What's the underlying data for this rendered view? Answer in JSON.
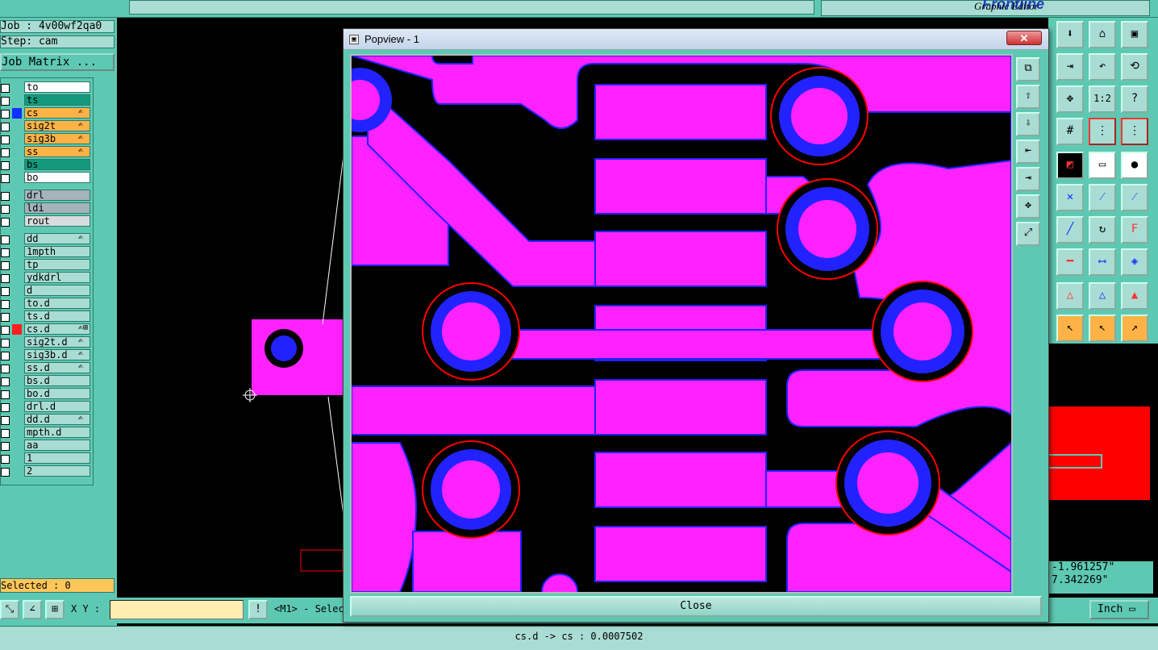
{
  "app": {
    "logo_text": "Frontline",
    "subtitle": "Graphic Editor"
  },
  "info": {
    "job": "Job : 4v00wf2qa0",
    "step": "Step: cam",
    "job_matrix": "Job Matrix ..."
  },
  "layers": [
    {
      "name": "to",
      "color": "#ffffff",
      "mark": "",
      "edit": ""
    },
    {
      "name": "ts",
      "color": "#139a7a",
      "mark": "",
      "edit": ""
    },
    {
      "name": "cs",
      "color": "#ffb347",
      "mark": "#1030ff",
      "edit": "✍"
    },
    {
      "name": "sig2t",
      "color": "#ffb347",
      "mark": "",
      "edit": "✍"
    },
    {
      "name": "sig3b",
      "color": "#ffb347",
      "mark": "",
      "edit": "✍"
    },
    {
      "name": "ss",
      "color": "#ffb347",
      "mark": "",
      "edit": "✍"
    },
    {
      "name": "bs",
      "color": "#139a7a",
      "mark": "",
      "edit": ""
    },
    {
      "name": "bo",
      "color": "#ffffff",
      "mark": "",
      "edit": ""
    },
    {
      "name": "drl",
      "color": "#a7b3bb",
      "mark": "",
      "edit": ""
    },
    {
      "name": "ldi",
      "color": "#a7b3bb",
      "mark": "",
      "edit": ""
    },
    {
      "name": "rout",
      "color": "#d9dcdc",
      "mark": "",
      "edit": ""
    },
    {
      "name": "dd",
      "color": "#a9dcd3",
      "mark": "",
      "edit": "✍"
    },
    {
      "name": "1mpth",
      "color": "#a9dcd3",
      "mark": "",
      "edit": ""
    },
    {
      "name": "tp",
      "color": "#a9dcd3",
      "mark": "",
      "edit": ""
    },
    {
      "name": "ydkdrl",
      "color": "#a9dcd3",
      "mark": "",
      "edit": ""
    },
    {
      "name": "d",
      "color": "#a9dcd3",
      "mark": "",
      "edit": ""
    },
    {
      "name": "to.d",
      "color": "#a9dcd3",
      "mark": "",
      "edit": ""
    },
    {
      "name": "ts.d",
      "color": "#a9dcd3",
      "mark": "",
      "edit": ""
    },
    {
      "name": "cs.d",
      "color": "#a9dcd3",
      "mark": "#ff2020",
      "edit": "✍⊞"
    },
    {
      "name": "sig2t.d",
      "color": "#a9dcd3",
      "mark": "",
      "edit": "✍"
    },
    {
      "name": "sig3b.d",
      "color": "#a9dcd3",
      "mark": "",
      "edit": "✍"
    },
    {
      "name": "ss.d",
      "color": "#a9dcd3",
      "mark": "",
      "edit": "✍"
    },
    {
      "name": "bs.d",
      "color": "#a9dcd3",
      "mark": "",
      "edit": ""
    },
    {
      "name": "bo.d",
      "color": "#a9dcd3",
      "mark": "",
      "edit": ""
    },
    {
      "name": "drl.d",
      "color": "#a9dcd3",
      "mark": "",
      "edit": ""
    },
    {
      "name": "dd.d",
      "color": "#a9dcd3",
      "mark": "",
      "edit": "✍"
    },
    {
      "name": "mpth.d",
      "color": "#a9dcd3",
      "mark": "",
      "edit": ""
    },
    {
      "name": "aa",
      "color": "#a9dcd3",
      "mark": "",
      "edit": ""
    },
    {
      "name": "1",
      "color": "#a9dcd3",
      "mark": "",
      "edit": ""
    },
    {
      "name": "2",
      "color": "#a9dcd3",
      "mark": "",
      "edit": ""
    }
  ],
  "selected": "Selected : 0",
  "bottom": {
    "xy_label": "X Y :",
    "xy_value": "",
    "mouse_hint": "<M1> - Selec",
    "unit": "Inch"
  },
  "status": "cs.d -> cs : 0.0007502",
  "coords": {
    "x": "-1.961257\"",
    "y": "7.342269\""
  },
  "popup": {
    "title": "Popview - 1",
    "close_label": "Close"
  },
  "colors": {
    "panel": "#5ec9b3",
    "copper": "#ff22ff",
    "pad_ring": "#2222ff",
    "highlight": "#ff0000"
  }
}
